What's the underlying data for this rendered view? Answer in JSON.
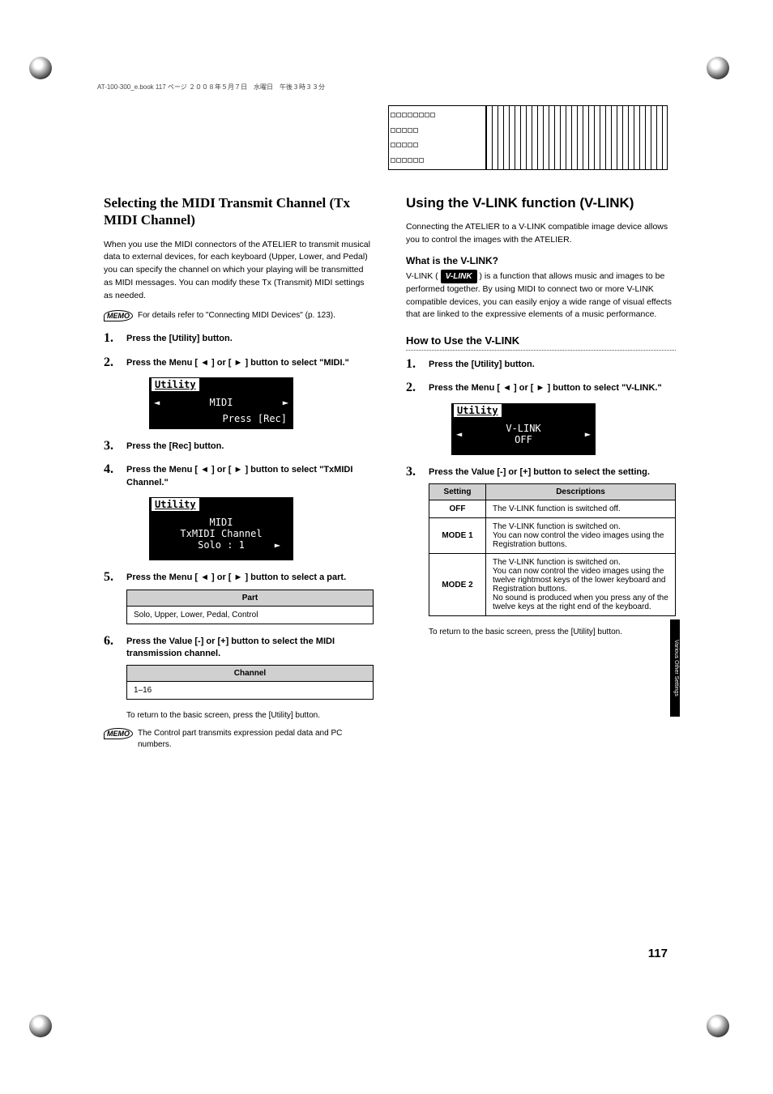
{
  "page_header": "AT-100-300_e.book  117 ページ  ２００８年５月７日　水曜日　午後３時３３分",
  "page_number": "117",
  "side_tab": "Various Other Settings",
  "left": {
    "title": "Selecting the MIDI Transmit Channel (Tx MIDI Channel)",
    "intro": "When you use the MIDI connectors of the ATELIER to transmit musical data to external devices, for each keyboard (Upper, Lower, and Pedal) you can specify the channel on which your playing will be transmitted as MIDI messages. You can modify these Tx (Transmit) MIDI settings as needed.",
    "memo1": "For details refer to \"Connecting MIDI Devices\" (p. 123).",
    "steps": {
      "s1": "Press the [Utility] button.",
      "s2": "Press the Menu [ ◄ ] or [ ► ] button to select \"MIDI.\"",
      "s3": "Press the [Rec] button.",
      "s4": "Press the Menu [ ◄ ] or [ ► ] button to select \"TxMIDI Channel.\"",
      "s5": "Press the Menu [ ◄ ] or [ ► ] button to select a part.",
      "s6": "Press the Value [-] or [+] button to select the MIDI transmission channel."
    },
    "lcd1_header": "Utility",
    "lcd1_line1": "MIDI",
    "lcd1_bottom": "Press [Rec]",
    "lcd2_header": "Utility",
    "lcd2_line1": "MIDI",
    "lcd2_line2": "TxMIDI Channel",
    "lcd2_line3": "Solo :  1",
    "part_table": {
      "header": "Part",
      "row": "Solo, Upper, Lower, Pedal, Control"
    },
    "channel_table": {
      "header": "Channel",
      "row": "1–16"
    },
    "return_note": "To return to the basic screen, press the [Utility] button.",
    "memo2": "The Control part transmits expression pedal data and PC numbers."
  },
  "right": {
    "title": "Using the V-LINK function (V-LINK)",
    "intro": "Connecting the ATELIER to a V-LINK compatible image device allows you to control the images with the ATELIER.",
    "q_title": "What is the V-LINK?",
    "q_text_prefix": "V-LINK (",
    "q_text_suffix": " ) is a function that allows music and images to be performed together. By using MIDI to connect two or more V-LINK compatible devices, you can easily enjoy a wide range of visual effects that are linked to the expressive elements of a music performance.",
    "vlink_badge": "V-LINK",
    "howto_title": "How to Use the V-LINK",
    "steps": {
      "s1": "Press the [Utility] button.",
      "s2": "Press the Menu [ ◄ ] or [ ► ] button to select \"V-LINK.\"",
      "s3": "Press the Value [-] or [+] button to select the setting."
    },
    "lcd_header": "Utility",
    "lcd_line1": "V-LINK",
    "lcd_line2": "OFF",
    "table": {
      "h1": "Setting",
      "h2": "Descriptions",
      "rows": [
        {
          "setting": "OFF",
          "desc": "The V-LINK function is switched off."
        },
        {
          "setting": "MODE 1",
          "desc": "The V-LINK function is switched on.\nYou can now control the video images using the Registration buttons."
        },
        {
          "setting": "MODE 2",
          "desc": "The V-LINK function is switched on.\nYou can now control the video images using the twelve rightmost keys of the lower keyboard and Registration buttons.\nNo sound is produced when you press any of the twelve keys at the right end of the keyboard."
        }
      ]
    },
    "return_note": "To return to the basic screen, press the [Utility] button."
  }
}
